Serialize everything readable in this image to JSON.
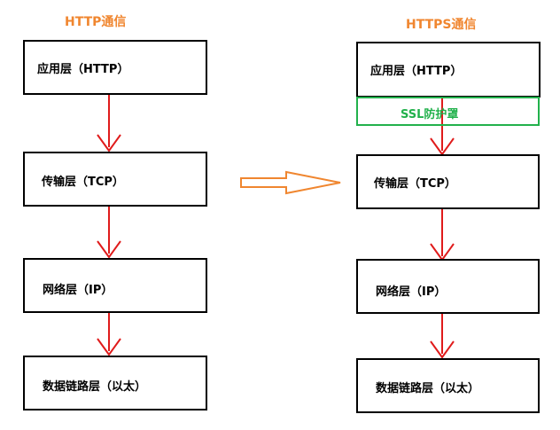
{
  "left": {
    "title": "HTTP通信",
    "layers": [
      "应用层（HTTP）",
      "传输层（TCP）",
      "网络层（IP）",
      "数据链路层（以太）"
    ]
  },
  "right": {
    "title": "HTTPS通信",
    "layers": [
      "应用层（HTTP）",
      "传输层（TCP）",
      "网络层（IP）",
      "数据链路层（以太）"
    ],
    "ssl_label": "SSL防护罩"
  },
  "colors": {
    "title": "#f0862f",
    "arrow": "#e01b1b",
    "ssl": "#22b14c",
    "transform_arrow": "#f0862f"
  }
}
